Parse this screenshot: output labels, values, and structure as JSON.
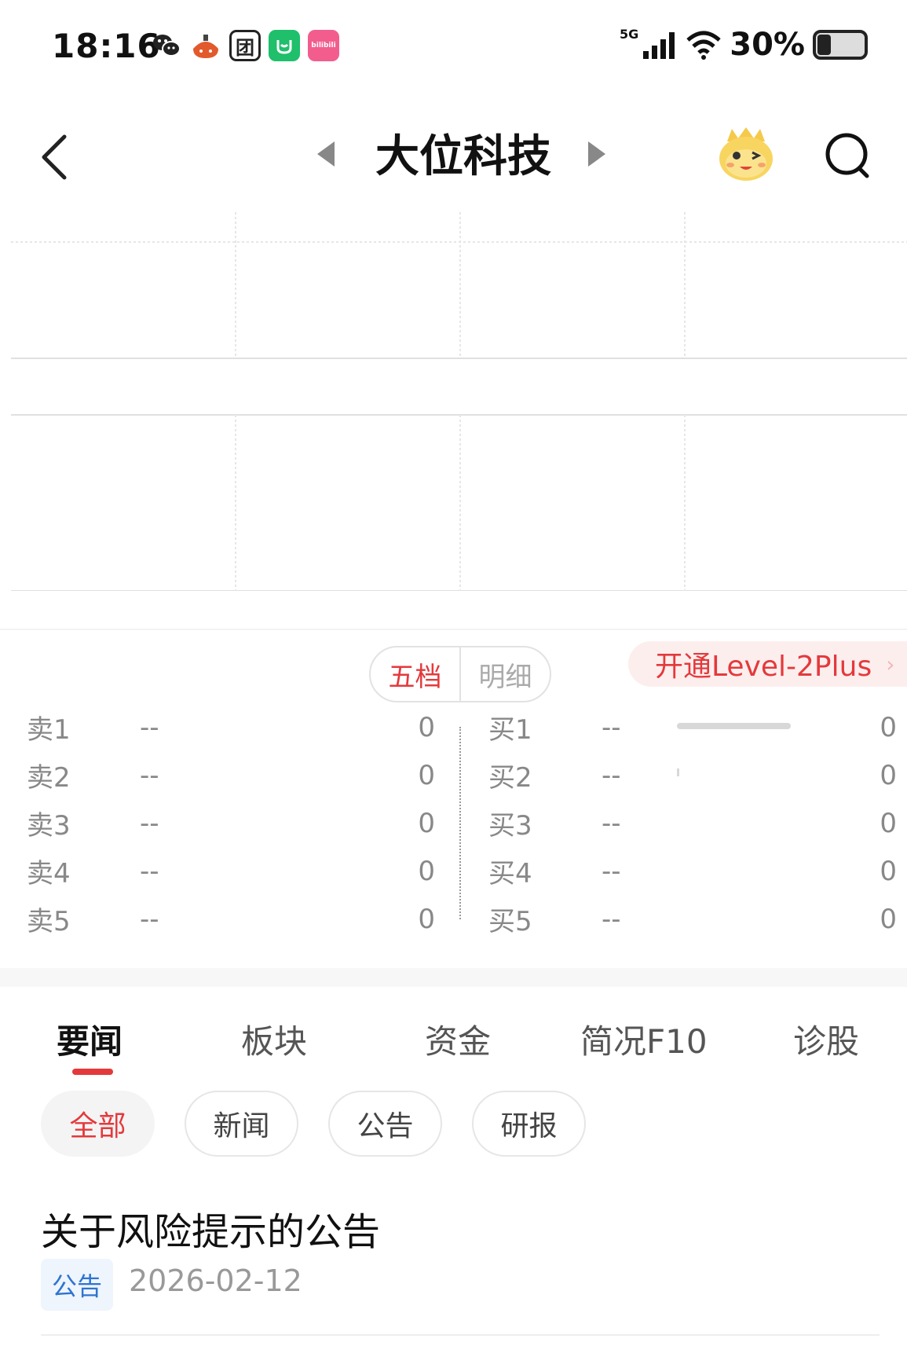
{
  "status_bar": {
    "time": "18:16",
    "network": "5G",
    "battery": "30%",
    "battery_level": 0.3,
    "app_icons": [
      "wechat-icon",
      "fruit-app-icon",
      "tuan-app-icon",
      "green-app-icon",
      "bilibili-icon"
    ],
    "app_icon_text": {
      "tuan": "团",
      "bili": "bilibili"
    }
  },
  "nav": {
    "title": "大位科技"
  },
  "orderbook": {
    "mode_tabs": [
      "五档",
      "明细"
    ],
    "level2_label": "开通Level-2Plus",
    "level2_chevron": "›",
    "sell": [
      {
        "label": "卖1",
        "price": "--",
        "volume": "0"
      },
      {
        "label": "卖2",
        "price": "--",
        "volume": "0"
      },
      {
        "label": "卖3",
        "price": "--",
        "volume": "0"
      },
      {
        "label": "卖4",
        "price": "--",
        "volume": "0"
      },
      {
        "label": "卖5",
        "price": "--",
        "volume": "0"
      }
    ],
    "buy": [
      {
        "label": "买1",
        "price": "--",
        "volume": "0"
      },
      {
        "label": "买2",
        "price": "--",
        "volume": "0"
      },
      {
        "label": "买3",
        "price": "--",
        "volume": "0"
      },
      {
        "label": "买4",
        "price": "--",
        "volume": "0"
      },
      {
        "label": "买5",
        "price": "--",
        "volume": "0"
      }
    ]
  },
  "tabs": [
    "要闻",
    "板块",
    "资金",
    "简况F10",
    "诊股"
  ],
  "chips": [
    "全部",
    "新闻",
    "公告",
    "研报"
  ],
  "news": [
    {
      "title": "关于风险提示的公告",
      "tag": "公告",
      "date": "2026-02-12"
    }
  ],
  "colors": {
    "accent_red": "#e4393c",
    "tag_blue": "#2f74d0"
  }
}
